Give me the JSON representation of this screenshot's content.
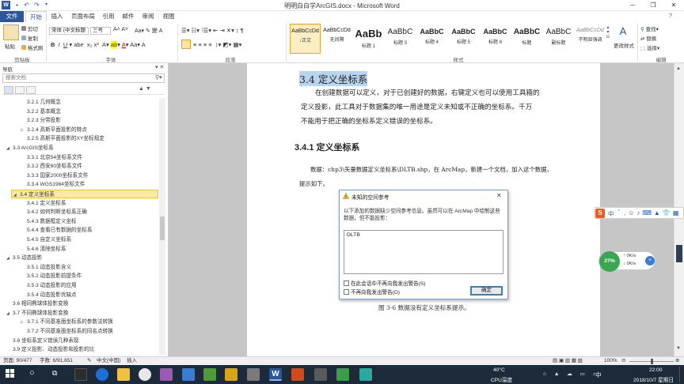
{
  "window": {
    "title": "明明白白学ArcGIS.docx - Microsoft Word"
  },
  "tabs": [
    "文件",
    "开始",
    "插入",
    "页面布局",
    "引用",
    "邮件",
    "审阅",
    "视图"
  ],
  "ribbon": {
    "clipboard": {
      "paste": "粘贴",
      "cut": "剪切",
      "copy": "复制",
      "format_painter": "格式刷",
      "label": "剪贴板"
    },
    "font": {
      "name": "宋体 (中文标题",
      "size": "三号",
      "label": "字体"
    },
    "paragraph": {
      "label": "段落"
    },
    "styles": {
      "label": "样式",
      "items": [
        {
          "sample": "AaBbCcDd",
          "name": "↓正文"
        },
        {
          "sample": "AaBbCcDd",
          "name": "无间隔"
        },
        {
          "sample": "AaBb",
          "name": "标题 1"
        },
        {
          "sample": "AaBbC",
          "name": "标题 3"
        },
        {
          "sample": "AaBbC",
          "name": "标题 4"
        },
        {
          "sample": "AaBbC",
          "name": "标题 5"
        },
        {
          "sample": "AaBbC",
          "name": "标题 6"
        },
        {
          "sample": "AaBbC",
          "name": "标题"
        },
        {
          "sample": "AaBbC",
          "name": "副标题"
        },
        {
          "sample": "AaBbCcDd",
          "name": "不明显强调"
        }
      ],
      "change_styles": "更改样式"
    },
    "editing": {
      "find": "查找",
      "replace": "替换",
      "select": "选择",
      "label": "编辑"
    }
  },
  "nav": {
    "header": "导航",
    "search_placeholder": "搜索文档",
    "items": [
      {
        "label": "3.2.1 几何概念",
        "level": 2,
        "selected": false
      },
      {
        "label": "3.2.2 基本概念",
        "level": 2,
        "selected": false
      },
      {
        "label": "3.2.3 分带投影",
        "level": 2,
        "selected": false
      },
      {
        "label": "3.2.4 高斯平面投影的特点",
        "level": 2,
        "selected": false,
        "collapsible": true
      },
      {
        "label": "3.2.5 高斯平面投影的XY坐标规定",
        "level": 2,
        "selected": false
      },
      {
        "label": "3.3 ArcGIS坐标系",
        "level": 1,
        "selected": false,
        "collapsible": true
      },
      {
        "label": "3.3.1 北京54坐标系文件",
        "level": 2,
        "selected": false
      },
      {
        "label": "3.3.2 西安80坐标系文件",
        "level": 2,
        "selected": false
      },
      {
        "label": "3.3.3 国家2000坐标系文件",
        "level": 2,
        "selected": false
      },
      {
        "label": "3.3.4 WGS1984坐标文件",
        "level": 2,
        "selected": false
      },
      {
        "label": "3.4 定义坐标系",
        "level": 1,
        "selected": true,
        "collapsible": true
      },
      {
        "label": "3.4.1 定义坐标系",
        "level": 2,
        "selected": false
      },
      {
        "label": "3.4.2 如何判断坐标系正确",
        "level": 2,
        "selected": false
      },
      {
        "label": "5.4.3 数据框定义坐标",
        "level": 2,
        "selected": false
      },
      {
        "label": "5.4.4 查看已有数据的坐标系",
        "level": 2,
        "selected": false
      },
      {
        "label": "5.4.5 自定义坐标系",
        "level": 2,
        "selected": false
      },
      {
        "label": "5.4.6 清除坐标系",
        "level": 2,
        "selected": false
      },
      {
        "label": "3.5 动态投影",
        "level": 1,
        "selected": false,
        "collapsible": true
      },
      {
        "label": "3.5.1 动态投影含义",
        "level": 2,
        "selected": false
      },
      {
        "label": "3.5.2 动态投影前提条件",
        "level": 2,
        "selected": false
      },
      {
        "label": "3.5.3 动态投影的应用",
        "level": 2,
        "selected": false
      },
      {
        "label": "3.5.4 动态投影优缺点",
        "level": 2,
        "selected": false
      },
      {
        "label": "3.6 相同椭球体投影变换",
        "level": 1,
        "selected": false
      },
      {
        "label": "3.7 不同椭球体投影变换",
        "level": 1,
        "selected": false,
        "collapsible": true
      },
      {
        "label": "3.7.1 不同基准面坐标系的参数法转换",
        "level": 2,
        "selected": false,
        "collapsible": true
      },
      {
        "label": "3.7.2 不同基准面坐标系的同名点转换",
        "level": 2,
        "selected": false
      },
      {
        "label": "3.8 坐标系定义错误几种表现",
        "level": 1,
        "selected": false
      },
      {
        "label": "3.9 定义投影、动态投影和投影的比",
        "level": 1,
        "selected": false
      }
    ]
  },
  "document": {
    "heading": "3.4  定义坐标系",
    "para1": [
      "在创建数据可以定义，对于已创建好的数据，右键定义也可以使用工具箱的",
      "定义投影，此工具对于数据集的唯一用途是定义未知或不正确的坐标系。千万",
      "不能用于把正确的坐标系定义错误的坐标系。"
    ],
    "subheading": "3.4.1  定义坐标系",
    "para2": [
      "数据：chp3\\矢量数据定义坐标系\\DLTB.shp，在 ArcMap，新建一个文档，加入这个数据，",
      "提示如下。"
    ],
    "caption": "图 3-6  数据没有定义坐标系提示。"
  },
  "dialog": {
    "title": "未知的空间参考",
    "message": "以下添加的数据缺少空间参考信息。虽然可以在 ArcMap 中绘制这些数据，但不能投影：",
    "items": [
      "DLTB"
    ],
    "check1": "在此会话中不再向我发出警告(S)",
    "check2": "不再向我发出警告(D)",
    "ok": "确定"
  },
  "widget": {
    "percent": "27%",
    "up": "0K/s",
    "down": "0K/s",
    "ime": "中"
  },
  "status": {
    "page": "页面: 90/477",
    "words": "字数: 6/91,651",
    "lang": "中文(中国)",
    "mode": "插入",
    "zoom": "100%"
  },
  "taskbar": {
    "temp": "40°C",
    "cpu": "CPU温度",
    "ime": "中",
    "time": "22:00",
    "date": "2018/10/7 星期日"
  }
}
